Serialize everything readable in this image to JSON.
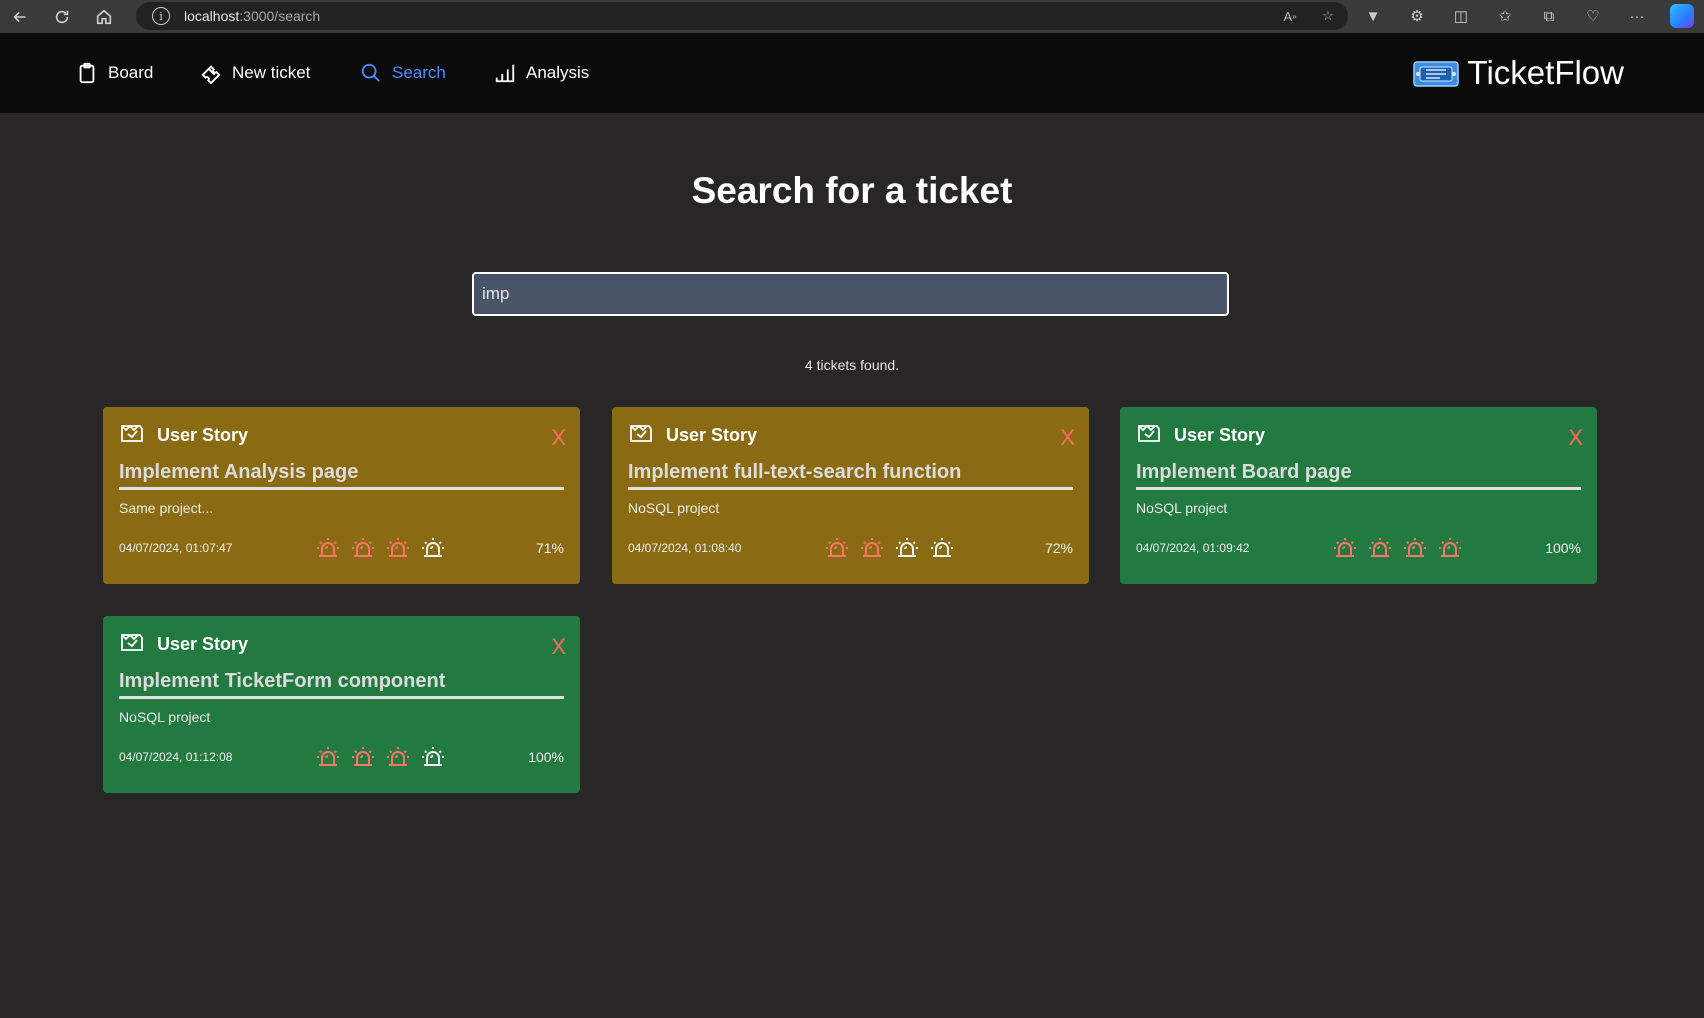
{
  "browser": {
    "url_host": "localhost",
    "url_path": ":3000/search"
  },
  "nav": {
    "items": [
      {
        "label": "Board",
        "icon": "clipboard-icon"
      },
      {
        "label": "New ticket",
        "icon": "ticket-icon"
      },
      {
        "label": "Search",
        "icon": "search-icon",
        "active": true
      },
      {
        "label": "Analysis",
        "icon": "bar-chart-icon"
      }
    ],
    "brand": "TicketFlow"
  },
  "page": {
    "title": "Search for a ticket",
    "search_value": "imp",
    "result_count": "4 tickets found."
  },
  "tickets": [
    {
      "type": "User Story",
      "title": "Implement Analysis page",
      "description": "Same project...",
      "date": "04/07/2024, 01:07:47",
      "priority": 3,
      "progress": "71%",
      "color": "#8a6b14"
    },
    {
      "type": "User Story",
      "title": "Implement full-text-search function",
      "description": "NoSQL project",
      "date": "04/07/2024, 01:08:40",
      "priority": 2,
      "progress": "72%",
      "color": "#8a6b14"
    },
    {
      "type": "User Story",
      "title": "Implement Board page",
      "description": "NoSQL project",
      "date": "04/07/2024, 01:09:42",
      "priority": 4,
      "progress": "100%",
      "color": "#237a40"
    },
    {
      "type": "User Story",
      "title": "Implement TicketForm component",
      "description": "NoSQL project",
      "date": "04/07/2024, 01:12:08",
      "priority": 3,
      "progress": "100%",
      "color": "#237a40"
    }
  ],
  "close_label": "X"
}
